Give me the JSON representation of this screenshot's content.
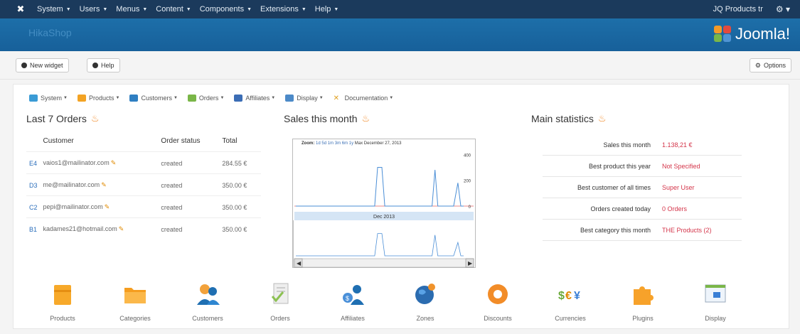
{
  "topbar": {
    "menus": [
      "System",
      "Users",
      "Menus",
      "Content",
      "Components",
      "Extensions",
      "Help"
    ],
    "user": "JQ Products tr"
  },
  "header": {
    "title": "HikaShop",
    "brand": "Joomla!"
  },
  "toolbar": {
    "new_widget": "New widget",
    "help": "Help",
    "options": "Options"
  },
  "hikamenu": {
    "items": [
      "System",
      "Products",
      "Customers",
      "Orders",
      "Affiliates",
      "Display",
      "Documentation"
    ],
    "colors": [
      "#3a9bd5",
      "#f3a324",
      "#2f7fc2",
      "#7ab648",
      "#3b6db5",
      "#4c8ac8",
      "#e0a020"
    ]
  },
  "orders": {
    "title": "Last 7 Orders",
    "headers": [
      "Customer",
      "Order status",
      "Total"
    ],
    "rows": [
      {
        "id": "E4",
        "customer": "vaios1@mailinator.com",
        "status": "created",
        "total": "284.55 €"
      },
      {
        "id": "D3",
        "customer": "me@mailinator.com",
        "status": "created",
        "total": "350.00 €"
      },
      {
        "id": "C2",
        "customer": "pepi@mailinator.com",
        "status": "created",
        "total": "350.00 €"
      },
      {
        "id": "B1",
        "customer": "kadames21@hotmail.com",
        "status": "created",
        "total": "350.00 €"
      }
    ]
  },
  "sales": {
    "title": "Sales this month",
    "zoom_label": "Zoom:",
    "zoom_options": [
      "1d",
      "5d",
      "1m",
      "3m",
      "6m",
      "1y",
      "Max"
    ],
    "date_label": "December 27, 2013",
    "nav_label": "Dec 2013",
    "y_ticks": [
      "400",
      "200",
      "0"
    ]
  },
  "chart_data": {
    "type": "line",
    "title": "Sales this month",
    "xlabel": "",
    "ylabel": "",
    "ylim": [
      0,
      440
    ],
    "y_ticks": [
      0,
      200,
      400
    ],
    "navigator_label": "Dec 2013",
    "series": [
      {
        "x": [
          0,
          10,
          20,
          30,
          40,
          50,
          55,
          57,
          60,
          62,
          65,
          70,
          80,
          90,
          95,
          97,
          99,
          101,
          103,
          106,
          110,
          113,
          115,
          117
        ],
        "values": [
          0,
          0,
          0,
          0,
          0,
          0,
          0,
          300,
          300,
          0,
          0,
          0,
          0,
          0,
          0,
          280,
          0,
          0,
          0,
          0,
          0,
          180,
          0,
          0
        ]
      }
    ],
    "color": "#4a8ed6"
  },
  "stats": {
    "title": "Main statistics",
    "rows": [
      {
        "label": "Sales this month",
        "value": "1.138,21 €"
      },
      {
        "label": "Best product this year",
        "value": "Not Specified"
      },
      {
        "label": "Best customer of all times",
        "value": "Super User"
      },
      {
        "label": "Orders created today",
        "value": "0 Orders"
      },
      {
        "label": "Best category this month",
        "value": "THE Products (2)"
      }
    ]
  },
  "icons": {
    "labels": [
      "Products",
      "Categories",
      "Customers",
      "Orders",
      "Affiliates",
      "Zones",
      "Discounts",
      "Currencies",
      "Plugins",
      "Display"
    ],
    "names": [
      "products-icon",
      "categories-icon",
      "customers-icon",
      "orders-icon",
      "affiliates-icon",
      "zones-icon",
      "discounts-icon",
      "currencies-icon",
      "plugins-icon",
      "display-icon"
    ]
  }
}
